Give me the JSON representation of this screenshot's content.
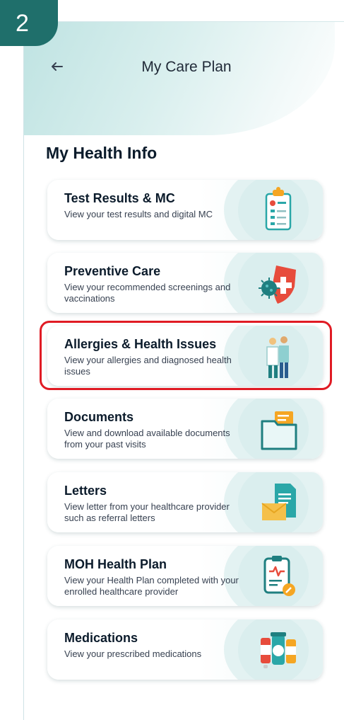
{
  "step_badge": "2",
  "header": {
    "title": "My Care Plan",
    "back_icon": "arrow-left-icon"
  },
  "section": {
    "title": "My Health Info"
  },
  "cards": [
    {
      "title": "Test Results & MC",
      "desc": "View your test results and digital MC",
      "icon": "clipboard-icon"
    },
    {
      "title": "Preventive Care",
      "desc": "View your recommended screenings and vaccinations",
      "icon": "virus-shield-icon"
    },
    {
      "title": "Allergies & Health Issues",
      "desc": "View your allergies and diagnosed health issues",
      "icon": "doctor-patient-icon"
    },
    {
      "title": "Documents",
      "desc": "View and download available documents from your past visits",
      "icon": "folder-icon"
    },
    {
      "title": "Letters",
      "desc": "View letter from your healthcare provider such as referral letters",
      "icon": "envelope-document-icon"
    },
    {
      "title": "MOH Health Plan",
      "desc": "View your Health Plan completed with your enrolled healthcare provider",
      "icon": "health-plan-clipboard-icon"
    },
    {
      "title": "Medications",
      "desc": "View your prescribed medications",
      "icon": "medicine-bottles-icon"
    }
  ],
  "colors": {
    "accent": "#1f6f6b",
    "highlight": "#e01b24",
    "header": "#bfe3e2",
    "icon_teal": "#2aa7a8",
    "icon_orange": "#f5a623"
  }
}
